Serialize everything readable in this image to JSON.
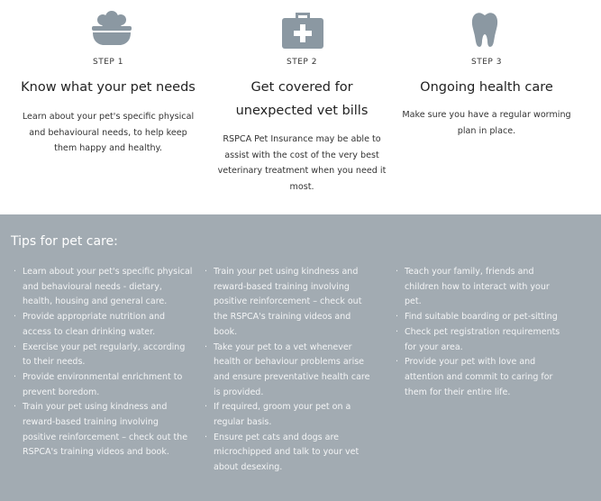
{
  "steps": [
    {
      "number": "STEP 1",
      "title": "Know what your pet needs",
      "description": "Learn about your pet's specific physical and behavioural needs, to help keep them happy and healthy.",
      "icon": "pet-bowl-icon"
    },
    {
      "number": "STEP 2",
      "title": "Get covered for unexpected vet bills",
      "description": "RSPCA Pet Insurance may be able to assist with the cost of the very best veterinary treatment when you need it most.",
      "icon": "first-aid-kit-icon"
    },
    {
      "number": "STEP 3",
      "title": "Ongoing health care",
      "description": "Make sure you have a regular worming plan in place.",
      "icon": "tooth-icon"
    }
  ],
  "tips": {
    "title": "Tips for pet care:",
    "columns": [
      [
        "Learn about your pet's specific physical and behavioural needs - dietary, health, housing and general care.",
        "Provide appropriate nutrition and access to clean drinking water.",
        "Exercise your pet regularly, according to their needs.",
        "Provide environmental enrichment to prevent boredom.",
        "Train your pet using kindness and reward-based training involving positive reinforcement – check out the RSPCA's training videos and book."
      ],
      [
        "Train your pet using kindness and reward-based training involving positive reinforcement – check out the RSPCA's training videos and book.",
        "Take your pet to a vet whenever health or behaviour problems arise and ensure preventative health care is provided.",
        "If required, groom your pet on a regular basis.",
        "Ensure pet cats and dogs are microchipped and talk to your vet about desexing."
      ],
      [
        "Teach your family, friends and children how to interact with your pet.",
        "Find suitable boarding or pet-sitting",
        "Check pet registration requirements for your area.",
        "Provide your pet with love and attention and commit to caring for them for their entire life."
      ]
    ]
  },
  "colors": {
    "icon": "#8b98a2",
    "tips_background": "#a2abb2",
    "tips_text": "#f4f5f6"
  }
}
